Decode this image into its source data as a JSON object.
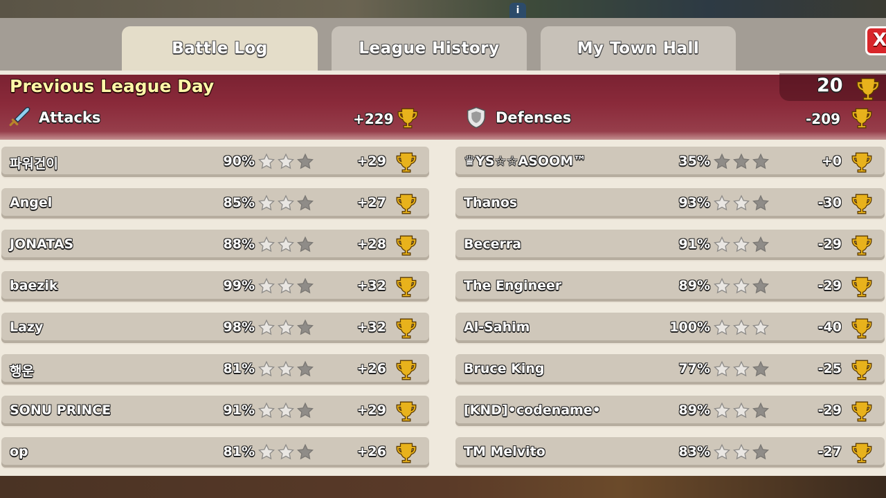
{
  "tabs": [
    {
      "label": "Battle Log",
      "active": true
    },
    {
      "label": "League History",
      "active": false
    },
    {
      "label": "My Town Hall",
      "active": false
    }
  ],
  "close_label": "X",
  "header": {
    "title": "Previous League Day",
    "total_trophies": "20"
  },
  "attacks": {
    "label": "Attacks",
    "total": "+229",
    "rows": [
      {
        "name": "파워건이",
        "percent": "90%",
        "stars": 2,
        "trophies": "+29"
      },
      {
        "name": "Angel",
        "percent": "85%",
        "stars": 2,
        "trophies": "+27"
      },
      {
        "name": "JONATAS",
        "percent": "88%",
        "stars": 2,
        "trophies": "+28"
      },
      {
        "name": "baezik",
        "percent": "99%",
        "stars": 2,
        "trophies": "+32"
      },
      {
        "name": "Lazy",
        "percent": "98%",
        "stars": 2,
        "trophies": "+32"
      },
      {
        "name": "행운",
        "percent": "81%",
        "stars": 2,
        "trophies": "+26"
      },
      {
        "name": "SONU PRINCE",
        "percent": "91%",
        "stars": 2,
        "trophies": "+29"
      },
      {
        "name": "op",
        "percent": "81%",
        "stars": 2,
        "trophies": "+26"
      }
    ]
  },
  "defenses": {
    "label": "Defenses",
    "total": "-209",
    "rows": [
      {
        "name": "♛YS☆☆ASOOM™",
        "percent": "35%",
        "stars": 0,
        "trophies": "+0"
      },
      {
        "name": "Thanos",
        "percent": "93%",
        "stars": 2,
        "trophies": "-30"
      },
      {
        "name": "Becerra",
        "percent": "91%",
        "stars": 2,
        "trophies": "-29"
      },
      {
        "name": "The Engineer",
        "percent": "89%",
        "stars": 2,
        "trophies": "-29"
      },
      {
        "name": "Al-Sahim",
        "percent": "100%",
        "stars": 3,
        "trophies": "-40"
      },
      {
        "name": "Bruce King",
        "percent": "77%",
        "stars": 2,
        "trophies": "-25"
      },
      {
        "name": "[KND]•codename•",
        "percent": "89%",
        "stars": 2,
        "trophies": "-29"
      },
      {
        "name": "TM Melvito",
        "percent": "83%",
        "stars": 2,
        "trophies": "-27"
      }
    ]
  },
  "colors": {
    "banner": "#8a2a3a",
    "title_yellow": "#fff7a8",
    "trophy_gold": "#e8b21c"
  }
}
